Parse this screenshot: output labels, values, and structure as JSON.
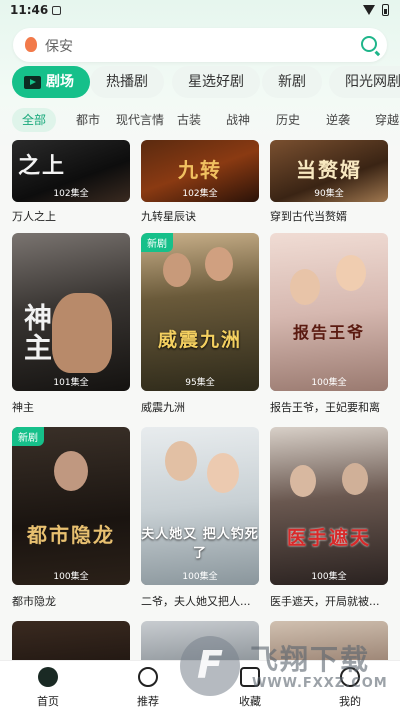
{
  "status": {
    "time": "11:46"
  },
  "search": {
    "placeholder": "保安"
  },
  "main_tabs": [
    "剧场",
    "热播剧",
    "星选好剧",
    "新剧",
    "阳光网剧"
  ],
  "sub_tabs": [
    "全部",
    "都市",
    "现代言情",
    "古装",
    "战神",
    "历史",
    "逆袭",
    "穿越"
  ],
  "cards": [
    {
      "name": "万人之上",
      "poster_title": "之上",
      "episodes": "102集全",
      "badge": ""
    },
    {
      "name": "九转星辰诀",
      "poster_title": "九转",
      "episodes": "102集全",
      "badge": ""
    },
    {
      "name": "穿到古代当赘婿",
      "poster_title": "当赘婿",
      "episodes": "90集全",
      "badge": ""
    },
    {
      "name": "神主",
      "poster_title": "神主",
      "episodes": "101集全",
      "badge": ""
    },
    {
      "name": "威震九洲",
      "poster_title": "威震九洲",
      "episodes": "95集全",
      "badge": "新剧"
    },
    {
      "name": "报告王爷，王妃要和离",
      "poster_title": "报告王爷",
      "episodes": "100集全",
      "badge": ""
    },
    {
      "name": "都市隐龙",
      "poster_title": "都市隐龙",
      "episodes": "100集全",
      "badge": "新剧"
    },
    {
      "name": "二爷，夫人她又把人...",
      "poster_title": "夫人她又 把人钓死了",
      "episodes": "100集全",
      "badge": ""
    },
    {
      "name": "医手遮天，开局就被...",
      "poster_title": "医手遮天",
      "episodes": "100集全",
      "badge": ""
    }
  ],
  "bottom_nav": [
    {
      "label": "首页"
    },
    {
      "label": "推荐"
    },
    {
      "label": "收藏"
    },
    {
      "label": "我的"
    }
  ],
  "watermark": {
    "cn": "飞翔下载",
    "url": "WWW.FXXZ.COM"
  },
  "colors": {
    "accent": "#16c08a"
  }
}
